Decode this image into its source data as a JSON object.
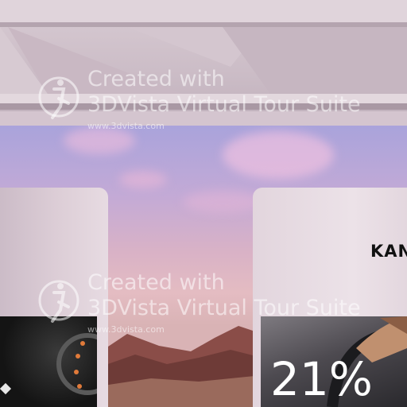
{
  "watermark": {
    "line1": "Created with",
    "line2": "3DVista Virtual Tour Suite",
    "url": "www.3dvista.com",
    "logo_icon": "3dvista-logo-icon"
  },
  "right_panel": {
    "brand": "KAN",
    "percentage": "21%"
  },
  "colors": {
    "sky_top": "#8d8fd2",
    "sky_bottom": "#e4bcc2",
    "panel": "#e2d5dd",
    "ceiling": "#cbbcc6"
  }
}
